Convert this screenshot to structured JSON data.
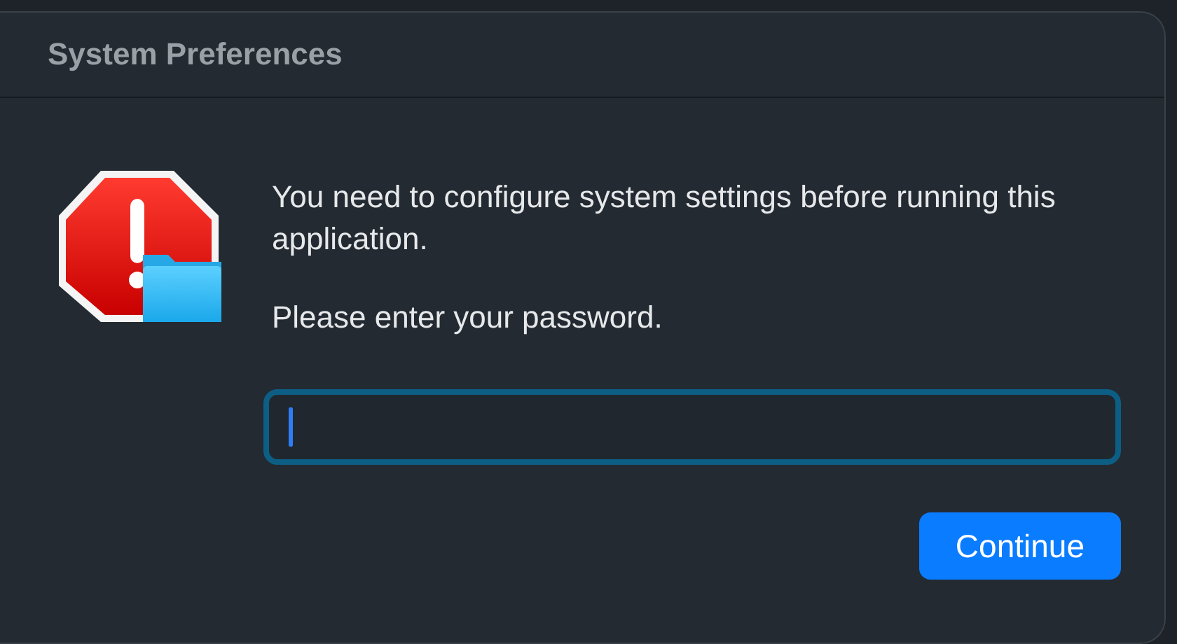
{
  "window": {
    "title": "System Preferences"
  },
  "message": {
    "lines": [
      "You need to configure system settings before running this application.",
      "Please enter your password."
    ]
  },
  "password_field": {
    "focused": true
  },
  "buttons": [
    {
      "label": "Continue",
      "kind": "primary"
    }
  ]
}
